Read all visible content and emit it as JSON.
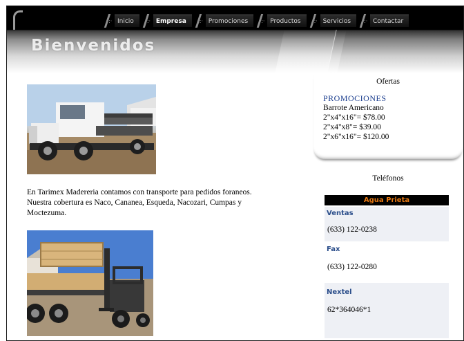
{
  "nav": {
    "items": [
      {
        "label": "Inicio",
        "active": false
      },
      {
        "label": "Empresa",
        "active": true
      },
      {
        "label": "Promociones",
        "active": false
      },
      {
        "label": "Productos",
        "active": false
      },
      {
        "label": "Servicios",
        "active": false
      },
      {
        "label": "Contactar",
        "active": false
      }
    ]
  },
  "header": {
    "welcome": "Bienvenidos"
  },
  "main": {
    "description": "En Tarimex Madereria contamos con transporte para pedidos foraneos. Nuestra cobertura es Naco, Cananea, Esqueda, Nacozari, Cumpas y Moctezuma."
  },
  "ofertas": {
    "title": "Ofertas",
    "promo_heading": "PROMOCIONES",
    "lines": [
      "Barrote Americano",
      "2\"x4\"x16\"= $78.00",
      "2\"x4\"x8\"= $39.00",
      "2\"x6\"x16\"= $120.00"
    ]
  },
  "telefonos": {
    "title": "Teléfonos",
    "region": "Agua Prieta",
    "ventas_label": "Ventas",
    "ventas_num": "(633) 122-0238",
    "fax_label": "Fax",
    "fax_num": "(633) 122-0280",
    "nextel_label": "Nextel",
    "nextel_num": "62*364046*1"
  },
  "colors": {
    "header_black": "#000000",
    "promo_blue": "#1d3f8f",
    "region_orange": "#e87811",
    "label_blue": "#2a4d8a"
  },
  "icons": [
    "nav-separator-icon"
  ]
}
